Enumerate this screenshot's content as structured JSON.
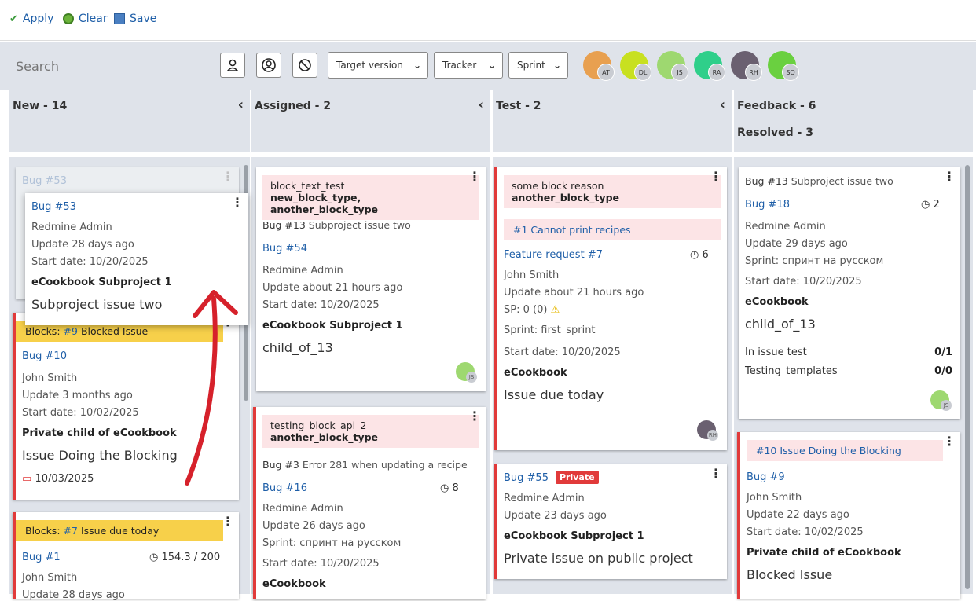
{
  "toolbar": {
    "apply": "Apply",
    "clear": "Clear",
    "save": "Save"
  },
  "filters": {
    "search_placeholder": "Search",
    "target_version": "Target version",
    "tracker": "Tracker",
    "sprint": "Sprint"
  },
  "avatars": [
    "AT",
    "DL",
    "JS",
    "RA",
    "RH",
    "SO"
  ],
  "columns": {
    "new": "New - 14",
    "assigned": "Assigned - 2",
    "test": "Test - 2",
    "feedback": "Feedback - 6",
    "resolved": "Resolved - 3"
  },
  "colors": {
    "link": "#1f5fa8",
    "red": "#e13a3a",
    "yellow": "#f7d04a",
    "pink": "#fce4e6",
    "bg": "#dfe3ea"
  },
  "new_cards": {
    "ghost": {
      "title": "Bug #53"
    },
    "dragged": {
      "title": "Bug #53",
      "author": "Redmine Admin",
      "update": "Update 28 days ago",
      "start": "Start date: 10/20/2025",
      "project": "eCookbook Subproject 1",
      "subject": "Subproject issue two"
    },
    "c2": {
      "block_label": "Blocks:",
      "block_ref": "#9",
      "block_text": "Blocked Issue",
      "title": "Bug #10",
      "author": "John Smith",
      "update": "Update 3 months ago",
      "start": "Start date: 10/02/2025",
      "project": "Private child of eCookbook",
      "subject": "Issue Doing the Blocking",
      "due": "10/03/2025"
    },
    "c3": {
      "block_label": "Blocks:",
      "block_ref": "#7",
      "block_text": "Issue due today",
      "title": "Bug #1",
      "time": "154.3 / 200",
      "author": "John Smith",
      "update": "Update 28 days ago"
    }
  },
  "assigned_cards": {
    "c1": {
      "block_reason": "block_text_test",
      "block_types": "new_block_type, another_block_type",
      "parent_tracker": "Bug #13",
      "parent_subject": "Subproject issue two",
      "title": "Bug #54",
      "author": "Redmine Admin",
      "update": "Update about 21 hours ago",
      "start": "Start date: 10/20/2025",
      "project": "eCookbook Subproject 1",
      "subject": "child_of_13",
      "avatar": "JS"
    },
    "c2": {
      "block_reason": "testing_block_api_2",
      "block_types": "another_block_type",
      "parent_tracker": "Bug #3",
      "parent_subject": "Error 281 when updating a recipe",
      "title": "Bug #16",
      "time": "8",
      "author": "Redmine Admin",
      "update": "Update 26 days ago",
      "sprint": "Sprint:  спринт на русском",
      "start": "Start date: 10/20/2025",
      "project": "eCookbook"
    }
  },
  "test_cards": {
    "c1": {
      "block_reason": "some block reason",
      "block_types": "another_block_type",
      "relation": "#1  Cannot print recipes",
      "title": "Feature request #7",
      "time": "6",
      "author": "John Smith",
      "update": "Update about 21 hours ago",
      "sp": "SP: 0 (0)",
      "sprint": "Sprint:  first_sprint",
      "start": "Start date: 10/20/2025",
      "project": "eCookbook",
      "subject": "Issue due today",
      "avatar": "RH"
    },
    "c2": {
      "title": "Bug #55",
      "private": "Private",
      "author": "Redmine Admin",
      "update": "Update 23 days ago",
      "project": "eCookbook Subproject 1",
      "subject": "Private issue on public project"
    }
  },
  "feedback_cards": {
    "c1": {
      "parent_tracker": "Bug #13",
      "parent_subject": "Subproject issue two",
      "title": "Bug #18",
      "time": "2",
      "author": "Redmine Admin",
      "update": "Update 29 days ago",
      "sprint": "Sprint:  спринт на русском",
      "start": "Start date: 10/20/2025",
      "project": "eCookbook",
      "subject": "child_of_13",
      "check1": "In issue test",
      "check1_val": "0/1",
      "check2": "Testing_templates",
      "check2_val": "0/0",
      "avatar": "JS"
    },
    "c2": {
      "relation": "#10  Issue Doing the Blocking",
      "title": "Bug #9",
      "author": "John Smith",
      "update": "Update 22 days ago",
      "start": "Start date: 10/02/2025",
      "project": "Private child of eCookbook",
      "subject": "Blocked Issue"
    }
  }
}
